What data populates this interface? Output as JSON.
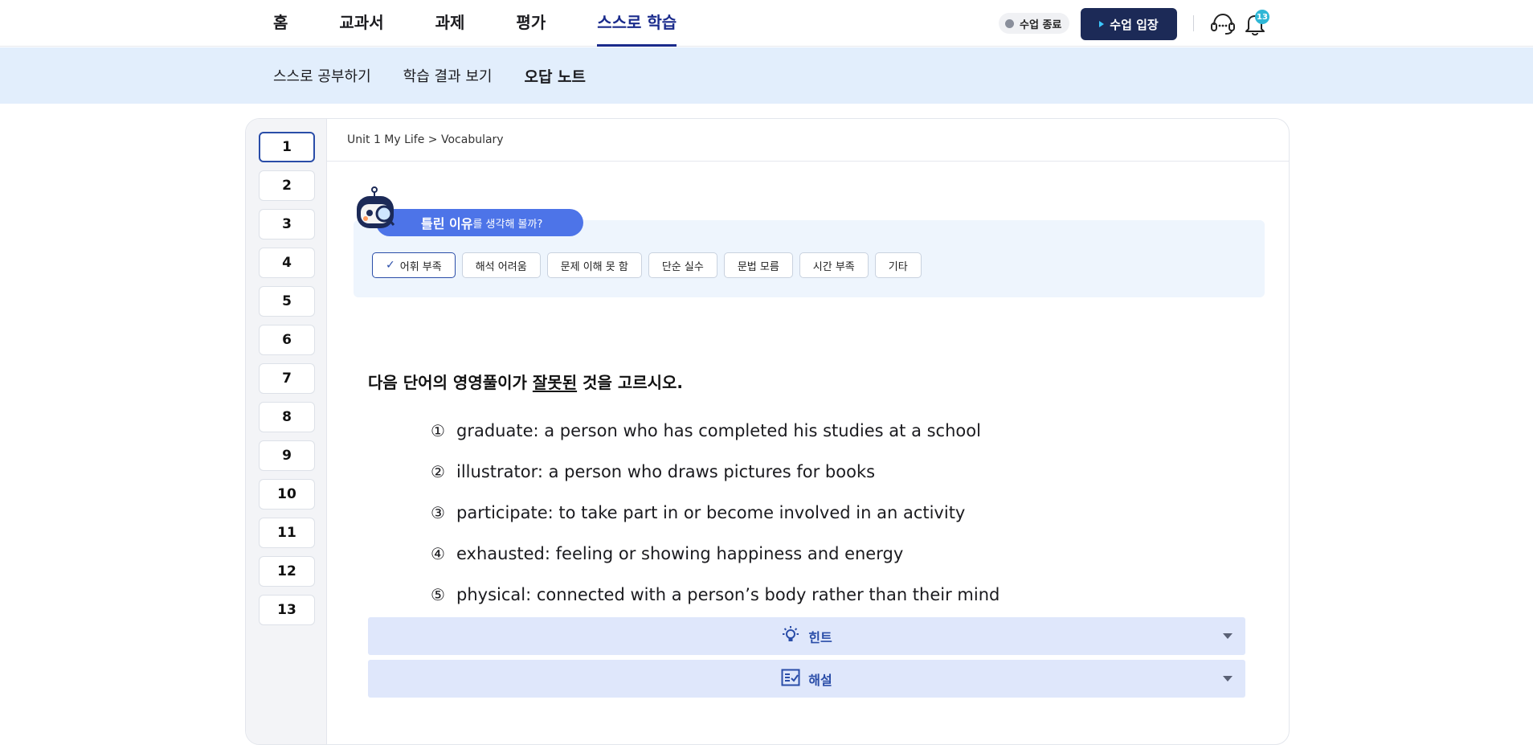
{
  "top_nav": {
    "items": [
      {
        "label": "홈",
        "active": false
      },
      {
        "label": "교과서",
        "active": false
      },
      {
        "label": "과제",
        "active": false
      },
      {
        "label": "평가",
        "active": false
      },
      {
        "label": "스스로 학습",
        "active": true
      }
    ],
    "status_label": "수업 종료",
    "enter_button": "수업 입장",
    "notification_count": "13",
    "accent_color": "#1a2b8c"
  },
  "sub_nav": {
    "items": [
      {
        "label": "스스로 공부하기",
        "active": false
      },
      {
        "label": "학습 결과 보기",
        "active": false
      },
      {
        "label": "오답 노트",
        "active": true
      }
    ]
  },
  "question_list": [
    "1",
    "2",
    "3",
    "4",
    "5",
    "6",
    "7",
    "8",
    "9",
    "10",
    "11",
    "12",
    "13"
  ],
  "active_question": "1",
  "breadcrumb": "Unit 1 My Life > Vocabulary",
  "reason": {
    "title_strong": "틀린 이유",
    "title_rest": "를 생각해 볼까?",
    "chips": [
      {
        "label": "어휘 부족",
        "selected": true
      },
      {
        "label": "해석 어려움",
        "selected": false
      },
      {
        "label": "문제 이해 못 함",
        "selected": false
      },
      {
        "label": "단순 실수",
        "selected": false
      },
      {
        "label": "문법 모름",
        "selected": false
      },
      {
        "label": "시간 부족",
        "selected": false
      },
      {
        "label": "기타",
        "selected": false
      }
    ]
  },
  "question": {
    "prefix": "다음 단어의 영영풀이가 ",
    "underlined": "잘못된",
    "suffix": " 것을 고르시오.",
    "options": [
      {
        "num": "①",
        "text": "graduate: a person who has completed his studies at a school"
      },
      {
        "num": "②",
        "text": "illustrator: a person who draws pictures for books"
      },
      {
        "num": "③",
        "text": "participate: to take part in or become involved in an activity"
      },
      {
        "num": "④",
        "text": "exhausted: feeling or showing happiness and energy"
      },
      {
        "num": "⑤",
        "text": "physical: connected with a person’s body rather than their mind"
      }
    ]
  },
  "accordions": {
    "hint_label": "힌트",
    "explanation_label": "해설"
  }
}
